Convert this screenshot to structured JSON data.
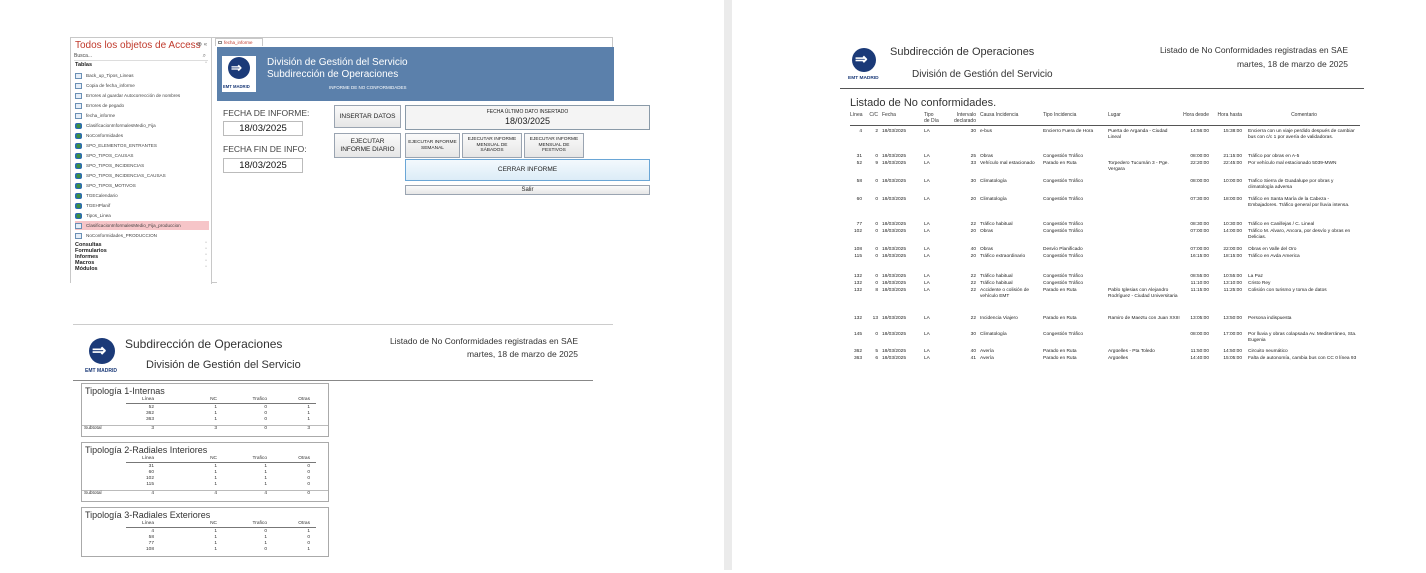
{
  "nav": {
    "title": "Todos los objetos de Access",
    "controls": "⊗ «",
    "search_placeholder": "Busca...",
    "sections": {
      "tablas": "Tablas",
      "consultas": "Consultas",
      "formularios": "Formularios",
      "informes": "Informes",
      "macros": "Macros",
      "modulos": "Módulos"
    },
    "items": [
      {
        "label": "Back_up_Tipos_Lineas",
        "kind": "table"
      },
      {
        "label": "Copia de fecha_informe",
        "kind": "table"
      },
      {
        "label": "Errores al guardar Autocorrección de nombres",
        "kind": "table"
      },
      {
        "label": "Errores de pegado",
        "kind": "table"
      },
      {
        "label": "fecha_informe",
        "kind": "table"
      },
      {
        "label": "ClasificacionInformalesMedio_Fija",
        "kind": "link"
      },
      {
        "label": "NoConformidades",
        "kind": "link"
      },
      {
        "label": "SPO_ELEMENTOS_ENTRANTES",
        "kind": "link"
      },
      {
        "label": "SPO_TIPOS_CAUSAS",
        "kind": "link"
      },
      {
        "label": "SPO_TIPOS_INCIDENCIAS",
        "kind": "link"
      },
      {
        "label": "SPO_TIPOS_INCIDENCIAS_CAUSAS",
        "kind": "link"
      },
      {
        "label": "SPO_TIPOS_MOTIVOS",
        "kind": "link"
      },
      {
        "label": "TGECalendario",
        "kind": "link"
      },
      {
        "label": "TGEHPlanif",
        "kind": "link"
      },
      {
        "label": "Tipos_Linea",
        "kind": "link"
      },
      {
        "label": "ClasificacionInformalesMedio_Fija_produccion",
        "kind": "table",
        "selected": true
      },
      {
        "label": "NoConformidades_PRODUCCION",
        "kind": "table"
      }
    ]
  },
  "form": {
    "tab_label": "fecha_informe",
    "logo_text": "EMT MADRID",
    "banner_line1": "División de Gestión del Servicio",
    "banner_line2": "Subdirección de Operaciones",
    "banner_line3": "INFORME DE NO CONFORMIDADES",
    "fecha_informe_label": "FECHA DE INFORME:",
    "fecha_informe_value": "18/03/2025",
    "fecha_fin_label": "FECHA FIN DE INFO:",
    "fecha_fin_value": "18/03/2025",
    "insertar_datos": "INSERTAR DATOS",
    "fecha_ultimo_label": "FECHA ÚLTIMO DATO INSERTADO",
    "fecha_ultimo_value": "18/03/2025",
    "ejecutar_diario": "EJECUTAR INFORME DIARIO",
    "ejecutar_semanal": "EJECUTAR INFORME SEMANAL",
    "ejecutar_sabados": "EJECUTAR INFORME MENSUAL DE SÁBADOS",
    "ejecutar_festivos": "EJECUTAR INFORME MENSUAL DE FESTIVOS",
    "cerrar": "CERRAR INFORME",
    "salir": "Salir"
  },
  "report_summary": {
    "logo_text": "EMT MADRID",
    "title1": "Subdirección de Operaciones",
    "title2": "División de Gestión del Servicio",
    "head1": "Listado de No Conformidades registradas en  SAE",
    "head2": "martes, 18 de marzo de 2025",
    "columns": [
      "Línea",
      "NC",
      "Trafico",
      "Otras"
    ],
    "subtotal_label": "Subtotal",
    "groups": [
      {
        "title": "Tipología 1-Internas",
        "rows": [
          [
            "52",
            "1",
            "0",
            "1"
          ],
          [
            "362",
            "1",
            "0",
            "1"
          ],
          [
            "363",
            "1",
            "0",
            "1"
          ]
        ],
        "subtotal": [
          "3",
          "3",
          "0",
          "3"
        ]
      },
      {
        "title": "Tipología 2-Radiales Interiores",
        "rows": [
          [
            "31",
            "1",
            "1",
            "0"
          ],
          [
            "60",
            "1",
            "1",
            "0"
          ],
          [
            "102",
            "1",
            "1",
            "0"
          ],
          [
            "115",
            "1",
            "1",
            "0"
          ]
        ],
        "subtotal": [
          "4",
          "4",
          "4",
          "0"
        ]
      },
      {
        "title": "Tipología 3-Radiales Exteriores",
        "rows": [
          [
            "4",
            "1",
            "0",
            "1"
          ],
          [
            "58",
            "1",
            "1",
            "0"
          ],
          [
            "77",
            "1",
            "1",
            "0"
          ],
          [
            "108",
            "1",
            "0",
            "1"
          ]
        ]
      }
    ]
  },
  "report_detail": {
    "logo_text": "EMT MADRID",
    "title1": "Subdirección de Operaciones",
    "title2": "División de Gestión del Servicio",
    "head1": "Listado de No Conformidades registradas en  SAE",
    "head2": "martes, 18 de marzo de 2025",
    "section_title": "Listado de No conformidades.",
    "columns": [
      "Línea",
      "C/C",
      "Fecha",
      "Tipo de Día",
      "Intervalo declarado",
      "Causa Incidencia",
      "Tipo Incidencia",
      "Lugar",
      "Hora desde",
      "Hora hasta",
      "Comentario"
    ],
    "rows": [
      [
        "4",
        "2",
        "18/03/2025",
        "LA",
        "30",
        "e-bus",
        "Encierro Fuera de Hora",
        "Puerta de Arganda - Ciudad Lineal",
        "14:56:00",
        "15:38:00",
        "Encierra con un viaje perdido después de cambiar bus con c/c 1 por avería de validadoras."
      ],
      [
        "31",
        "0",
        "18/03/2025",
        "LA",
        "25",
        "Obras",
        "Congestión Tráfico",
        "",
        "08:00:00",
        "21:15:00",
        "Tráfico por obras en A-5"
      ],
      [
        "52",
        "9",
        "18/03/2025",
        "LA",
        "33",
        "Vehículo mal estacionado",
        "Parado en Ruta",
        "Torpedero Tucumán 3 - Pge. Vergara",
        "22:20:00",
        "22:45:00",
        "Por vehículo mal estacionado 5039-MWN"
      ],
      [
        "58",
        "0",
        "18/03/2025",
        "LA",
        "30",
        "Climatología",
        "Congestión Tráfico",
        "",
        "08:00:00",
        "10:00:00",
        "Trafico Sierra de Guadalupe por obras y climatología adversa"
      ],
      [
        "60",
        "0",
        "18/03/2025",
        "LA",
        "20",
        "Climatología",
        "Congestión Tráfico",
        "",
        "07:30:00",
        "18:00:00",
        "Tráfico en Santa María de la Cabeza - Embajadores. Tráfico general por lluvia intensa."
      ],
      [
        "77",
        "0",
        "18/03/2025",
        "LA",
        "22",
        "Tráfico habitual",
        "Congestión Tráfico",
        "",
        "08:30:00",
        "10:30:00",
        "Tráfico en Canillejas / C. Lineal"
      ],
      [
        "102",
        "0",
        "18/03/2025",
        "LA",
        "20",
        "Obras",
        "Congestión Tráfico",
        "",
        "07:00:00",
        "14:00:00",
        "Tráfico M. Alvaro, Ancora, por desvío y obras en Delicias."
      ],
      [
        "108",
        "0",
        "18/03/2025",
        "LA",
        "40",
        "Obras",
        "Desvío Planificado",
        "",
        "07:00:00",
        "22:00:00",
        "Obras en Valle del Oro"
      ],
      [
        "115",
        "0",
        "18/03/2025",
        "LA",
        "20",
        "Tráfico extraordinario",
        "Congestión Tráfico",
        "",
        "16:15:00",
        "18:15:00",
        "Tráfico en Avda America"
      ],
      [
        "132",
        "0",
        "18/03/2025",
        "LA",
        "22",
        "Tráfico habitual",
        "Congestión Tráfico",
        "",
        "08:55:00",
        "10:55:00",
        "La Paz"
      ],
      [
        "132",
        "0",
        "18/03/2025",
        "LA",
        "22",
        "Tráfico habitual",
        "Congestión Tráfico",
        "",
        "11:10:00",
        "13:10:00",
        "Cristo Rey"
      ],
      [
        "132",
        "8",
        "18/03/2025",
        "LA",
        "22",
        "Accidente o colisión de vehículo EMT",
        "Parado en Ruta",
        "Pablo Iglesias con Alejandro Rodríguez - Ciudad Universitaria",
        "11:15:00",
        "11:25:00",
        "Colisión con turismo y toma de datos"
      ],
      [
        "132",
        "13",
        "18/03/2025",
        "LA",
        "22",
        "Incidencia Viajero",
        "Parado en Ruta",
        "Ramiro de Maeztu con Juan XXIII",
        "13:05:00",
        "13:50:00",
        "Persona indispuesta"
      ],
      [
        "145",
        "0",
        "18/03/2025",
        "LA",
        "30",
        "Climatología",
        "Congestión Tráfico",
        "",
        "08:00:00",
        "17:00:00",
        "Por lluvia y obras colapsada Av. Mediterráneo, Sta. Eugenia"
      ],
      [
        "362",
        "5",
        "18/03/2025",
        "LA",
        "40",
        "Avería",
        "Parado en Ruta",
        "Argüelles - Pta Toledo",
        "11:50:00",
        "14:50:00",
        "Circuito neumático"
      ],
      [
        "363",
        "6",
        "18/03/2025",
        "LA",
        "41",
        "Avería",
        "Parado en Ruta",
        "Argüelles",
        "14:40:00",
        "15:05:00",
        "Falta de autonomía, cambia bus con CC 0 línea 93"
      ]
    ]
  }
}
